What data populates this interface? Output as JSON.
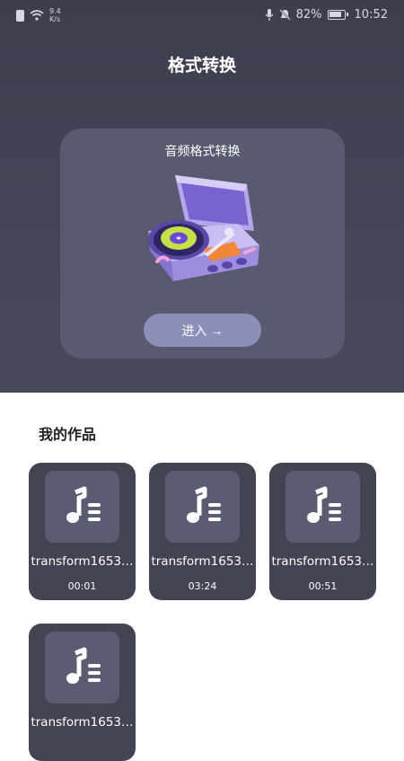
{
  "status_bar": {
    "net_speed_value": "9.4",
    "net_speed_unit": "K/s",
    "battery": "82%",
    "time": "10:52"
  },
  "page": {
    "title": "格式转换"
  },
  "feature_card": {
    "title": "音频格式转换",
    "enter_label": "进入 →"
  },
  "works": {
    "section_title": "我的作品",
    "items": [
      {
        "name": "transform1653…",
        "duration": "00:01"
      },
      {
        "name": "transform1653…",
        "duration": "03:24"
      },
      {
        "name": "transform1653…",
        "duration": "00:51"
      },
      {
        "name": "transform1653…",
        "duration": ""
      }
    ]
  },
  "colors": {
    "top_background": "#41434f",
    "card": "#585b6f",
    "button": "#8c8fb8",
    "work_card": "#424453"
  }
}
